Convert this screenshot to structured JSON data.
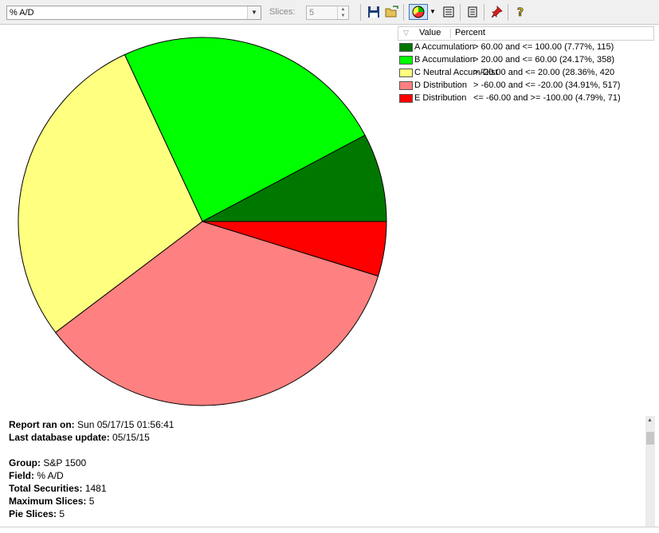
{
  "toolbar": {
    "field_value": "% A/D",
    "slices_label": "Slices:",
    "slices_value": "5"
  },
  "legend": {
    "header_value": "Value",
    "header_percent": "Percent",
    "items": [
      {
        "label": "A Accumulation",
        "range": "> 60.00 and <= 100.00 (7.77%, 115)",
        "color": "#007800"
      },
      {
        "label": "B Accumulation",
        "range": "> 20.00 and <= 60.00 (24.17%, 358)",
        "color": "#00ff00"
      },
      {
        "label": "C Neutral Accum/Dist",
        "range": "> -20.00 and <= 20.00 (28.36%, 420",
        "color": "#ffff80"
      },
      {
        "label": "D Distribution",
        "range": "> -60.00 and <= -20.00 (34.91%, 517)",
        "color": "#ff8080"
      },
      {
        "label": "E Distribution",
        "range": "<= -60.00 and >= -100.00 (4.79%, 71)",
        "color": "#ff0000"
      }
    ]
  },
  "chart_data": {
    "type": "pie",
    "categories": [
      "A Accumulation",
      "B Accumulation",
      "C Neutral Accum/Dist",
      "D Distribution",
      "E Distribution"
    ],
    "values": [
      7.77,
      24.17,
      28.36,
      34.91,
      4.79
    ],
    "counts": [
      115,
      358,
      420,
      517,
      71
    ],
    "colors": [
      "#007800",
      "#00ff00",
      "#ffff80",
      "#ff8080",
      "#ff0000"
    ]
  },
  "report": {
    "ran_on_label": "Report ran on:",
    "ran_on_value": "Sun 05/17/15 01:56:41",
    "db_update_label": "Last database update:",
    "db_update_value": "05/15/15",
    "group_label": "Group:",
    "group_value": "S&P 1500",
    "field_label": "Field:",
    "field_value": "% A/D",
    "total_label": "Total Securities:",
    "total_value": "1481",
    "max_slices_label": "Maximum Slices:",
    "max_slices_value": "5",
    "pie_slices_label": "Pie Slices:",
    "pie_slices_value": "5"
  },
  "icons": {
    "save": "save-icon",
    "open": "open-folder-icon",
    "chart": "pie-chart-icon",
    "list": "list-icon",
    "report": "report-icon",
    "pin": "pin-icon",
    "help": "help-icon"
  }
}
